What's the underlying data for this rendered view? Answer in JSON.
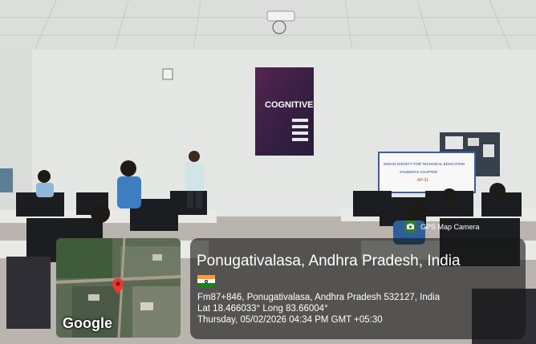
{
  "overlay": {
    "app_label": "GPS Map Camera",
    "app_icon": "camera-icon",
    "location_title": "Ponugativalasa, Andhra Pradesh, India",
    "flag": "india-flag-icon",
    "address": "Fm87+846, Ponugativalasa, Andhra Pradesh 532127, India",
    "coordinates": "Lat 18.466033° Long 83.66004°",
    "datetime": "Thursday, 05/02/2026 04:34 PM GMT +05:30",
    "map_brand": "Google",
    "map_marker": "location-pin-icon"
  },
  "projector_slide": {
    "heading": "COGNITIVE"
  },
  "banner": {
    "line1": "INDIAN SOCIETY FOR TECHNICAL EDUCATION",
    "line2": "STUDENTS CHAPTER",
    "line3": "AP-31"
  },
  "colors": {
    "wall": "#e4e6e3",
    "ceiling": "#dcdedb",
    "floor": "#b9b4ad",
    "slide_bg": "#2b1e3d",
    "slide_accent": "#c0398a",
    "flag_saffron": "#ff9933",
    "flag_green": "#138808"
  }
}
